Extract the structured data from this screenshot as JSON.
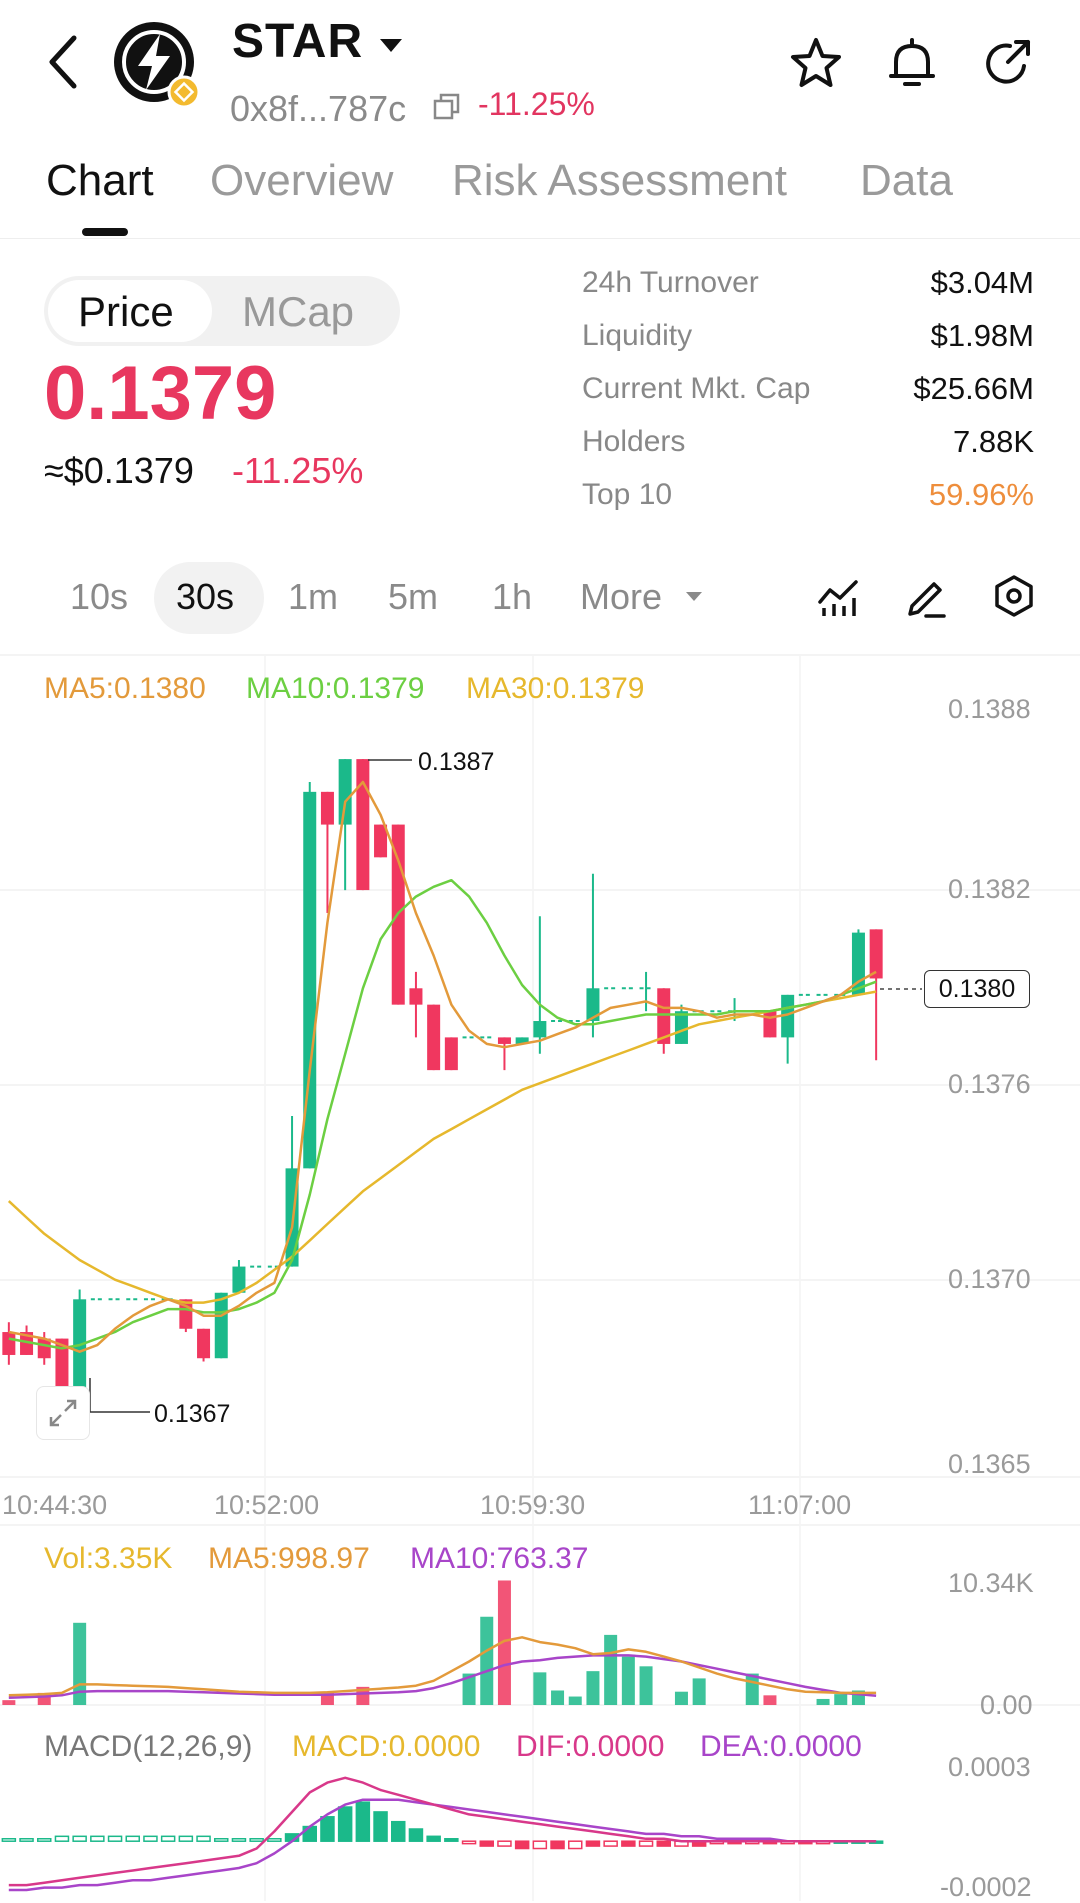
{
  "header": {
    "token_name": "STAR",
    "address": "0x8f...787c",
    "change": "-11.25%",
    "icons": [
      "back-arrow-icon",
      "caret-down-icon",
      "copy-icon",
      "star-icon",
      "bell-icon",
      "share-icon"
    ]
  },
  "tabs": [
    {
      "label": "Chart",
      "active": true
    },
    {
      "label": "Overview",
      "active": false
    },
    {
      "label": "Risk Assessment",
      "active": false
    },
    {
      "label": "Data",
      "active": false
    }
  ],
  "price_panel": {
    "toggle": [
      "Price",
      "MCap"
    ],
    "price": "0.1379",
    "usd_price": "≈$0.1379",
    "change": "-11.25%"
  },
  "stats": [
    {
      "label": "24h   Turnover",
      "value": "$3.04M"
    },
    {
      "label": "Liquidity",
      "value": "$1.98M"
    },
    {
      "label": "Current Mkt. Cap",
      "value": "$25.66M"
    },
    {
      "label": "Holders",
      "value": "7.88K"
    },
    {
      "label": "Top 10",
      "value": "59.96%"
    }
  ],
  "intervals": [
    "10s",
    "30s",
    "1m",
    "5m",
    "1h",
    "More"
  ],
  "selected_interval": "30s",
  "colors": {
    "up": "#1bb98a",
    "down": "#f0375f",
    "ma5": "#e39a3b",
    "ma10": "#6ccf42",
    "ma30": "#e6b82d",
    "macd": "#e6b82d",
    "dif": "#d8388a",
    "dea": "#a845c9"
  },
  "chart": {
    "ma_labels": [
      "MA5:0.1380",
      "MA10:0.1379",
      "MA30:0.1379"
    ],
    "y_labels": [
      "0.1388",
      "0.1382",
      "0.1376",
      "0.1370",
      "0.1365"
    ],
    "x_labels": [
      "10:44:30",
      "10:52:00",
      "10:59:30",
      "11:07:00"
    ],
    "high_label": "0.1387",
    "low_label": "0.1367",
    "last_price_tag": "0.1380",
    "volume_labels": [
      "Vol:3.35K",
      "MA5:998.97",
      "MA10:763.37"
    ],
    "volume_axis": [
      "10.34K",
      "0.00"
    ],
    "macd_labels": [
      "MACD(12,26,9)",
      "MACD:0.0000",
      "DIF:0.0000",
      "DEA:0.0000"
    ],
    "macd_axis": [
      "0.0003",
      "-0.0002"
    ]
  },
  "chart_data": {
    "type": "candlestick",
    "y_range": [
      0.1365,
      0.1388
    ],
    "candles": [
      {
        "o": 0.1369,
        "h": 0.13693,
        "l": 0.1368,
        "c": 0.13683
      },
      {
        "o": 0.1369,
        "h": 0.13692,
        "l": 0.13683,
        "c": 0.13683
      },
      {
        "o": 0.13688,
        "h": 0.1369,
        "l": 0.1368,
        "c": 0.13682
      },
      {
        "o": 0.13688,
        "h": 0.13688,
        "l": 0.13669,
        "c": 0.13671
      },
      {
        "o": 0.13671,
        "h": 0.13703,
        "l": 0.13669,
        "c": 0.137
      },
      {
        "o": 0.137,
        "h": 0.137,
        "l": 0.137,
        "c": 0.137
      },
      {
        "o": 0.137,
        "h": 0.137,
        "l": 0.137,
        "c": 0.137
      },
      {
        "o": 0.137,
        "h": 0.137,
        "l": 0.137,
        "c": 0.137
      },
      {
        "o": 0.137,
        "h": 0.137,
        "l": 0.137,
        "c": 0.137
      },
      {
        "o": 0.137,
        "h": 0.137,
        "l": 0.137,
        "c": 0.137
      },
      {
        "o": 0.137,
        "h": 0.137,
        "l": 0.1369,
        "c": 0.13691
      },
      {
        "o": 0.13691,
        "h": 0.13691,
        "l": 0.13681,
        "c": 0.13682
      },
      {
        "o": 0.13682,
        "h": 0.13702,
        "l": 0.13682,
        "c": 0.13702
      },
      {
        "o": 0.13702,
        "h": 0.13712,
        "l": 0.13702,
        "c": 0.1371
      },
      {
        "o": 0.1371,
        "h": 0.1371,
        "l": 0.1371,
        "c": 0.1371
      },
      {
        "o": 0.1371,
        "h": 0.1371,
        "l": 0.1371,
        "c": 0.1371
      },
      {
        "o": 0.1371,
        "h": 0.13756,
        "l": 0.1371,
        "c": 0.1374
      },
      {
        "o": 0.1374,
        "h": 0.13858,
        "l": 0.1374,
        "c": 0.13855
      },
      {
        "o": 0.13855,
        "h": 0.13855,
        "l": 0.13818,
        "c": 0.13845
      },
      {
        "o": 0.13845,
        "h": 0.13865,
        "l": 0.13825,
        "c": 0.13865
      },
      {
        "o": 0.13865,
        "h": 0.13865,
        "l": 0.13825,
        "c": 0.13825
      },
      {
        "o": 0.13845,
        "h": 0.13845,
        "l": 0.13835,
        "c": 0.13835
      },
      {
        "o": 0.13845,
        "h": 0.13845,
        "l": 0.1379,
        "c": 0.1379
      },
      {
        "o": 0.13795,
        "h": 0.138,
        "l": 0.1378,
        "c": 0.1379
      },
      {
        "o": 0.1379,
        "h": 0.1379,
        "l": 0.1377,
        "c": 0.1377
      },
      {
        "o": 0.1378,
        "h": 0.1378,
        "l": 0.1377,
        "c": 0.1377
      },
      {
        "o": 0.1378,
        "h": 0.1378,
        "l": 0.1378,
        "c": 0.1378
      },
      {
        "o": 0.1378,
        "h": 0.1378,
        "l": 0.1378,
        "c": 0.1378
      },
      {
        "o": 0.1378,
        "h": 0.1378,
        "l": 0.1377,
        "c": 0.13778
      },
      {
        "o": 0.13778,
        "h": 0.1378,
        "l": 0.13778,
        "c": 0.1378
      },
      {
        "o": 0.1378,
        "h": 0.13817,
        "l": 0.13775,
        "c": 0.13785
      },
      {
        "o": 0.13785,
        "h": 0.13785,
        "l": 0.13785,
        "c": 0.13785
      },
      {
        "o": 0.13785,
        "h": 0.13785,
        "l": 0.13785,
        "c": 0.13785
      },
      {
        "o": 0.13785,
        "h": 0.1383,
        "l": 0.1378,
        "c": 0.13795
      },
      {
        "o": 0.13795,
        "h": 0.13795,
        "l": 0.13795,
        "c": 0.13795
      },
      {
        "o": 0.13795,
        "h": 0.13795,
        "l": 0.13795,
        "c": 0.13795
      },
      {
        "o": 0.13795,
        "h": 0.138,
        "l": 0.13788,
        "c": 0.13795
      },
      {
        "o": 0.13795,
        "h": 0.13795,
        "l": 0.13775,
        "c": 0.13778
      },
      {
        "o": 0.13778,
        "h": 0.1379,
        "l": 0.13778,
        "c": 0.13788
      },
      {
        "o": 0.13788,
        "h": 0.13788,
        "l": 0.13788,
        "c": 0.13788
      },
      {
        "o": 0.13788,
        "h": 0.13788,
        "l": 0.13788,
        "c": 0.13788
      },
      {
        "o": 0.13788,
        "h": 0.13792,
        "l": 0.13785,
        "c": 0.13788
      },
      {
        "o": 0.13788,
        "h": 0.13788,
        "l": 0.13788,
        "c": 0.13788
      },
      {
        "o": 0.13788,
        "h": 0.13788,
        "l": 0.1378,
        "c": 0.1378
      },
      {
        "o": 0.1378,
        "h": 0.13793,
        "l": 0.13772,
        "c": 0.13793
      },
      {
        "o": 0.13793,
        "h": 0.13793,
        "l": 0.13793,
        "c": 0.13793
      },
      {
        "o": 0.13793,
        "h": 0.13793,
        "l": 0.13793,
        "c": 0.13793
      },
      {
        "o": 0.13793,
        "h": 0.13793,
        "l": 0.13793,
        "c": 0.13793
      },
      {
        "o": 0.13793,
        "h": 0.13813,
        "l": 0.13793,
        "c": 0.13812
      },
      {
        "o": 0.13813,
        "h": 0.13813,
        "l": 0.13773,
        "c": 0.13798
      }
    ],
    "ma5": [
      0.1369,
      0.13689,
      0.13688,
      0.13686,
      0.13684,
      0.13686,
      0.13691,
      0.13695,
      0.13698,
      0.137,
      0.13698,
      0.13695,
      0.13695,
      0.13698,
      0.13702,
      0.13705,
      0.13722,
      0.1377,
      0.13815,
      0.13852,
      0.13858,
      0.13848,
      0.13834,
      0.13818,
      0.13805,
      0.1379,
      0.13782,
      0.13778,
      0.13777,
      0.13778,
      0.13779,
      0.13781,
      0.13783,
      0.13786,
      0.13789,
      0.1379,
      0.13791,
      0.13789,
      0.13789,
      0.13788,
      0.13786,
      0.13787,
      0.13787,
      0.13786,
      0.13787,
      0.13789,
      0.13791,
      0.13793,
      0.13797,
      0.138
    ],
    "ma10": [
      0.13688,
      0.13687,
      0.13686,
      0.13685,
      0.13686,
      0.13688,
      0.1369,
      0.13693,
      0.13695,
      0.13697,
      0.13697,
      0.13696,
      0.13696,
      0.13697,
      0.13699,
      0.13702,
      0.13712,
      0.13732,
      0.13755,
      0.13775,
      0.13795,
      0.1381,
      0.13818,
      0.13823,
      0.13826,
      0.13828,
      0.13823,
      0.13815,
      0.13805,
      0.13796,
      0.1379,
      0.13786,
      0.13784,
      0.13784,
      0.13785,
      0.13786,
      0.13787,
      0.13787,
      0.13787,
      0.13787,
      0.13787,
      0.13788,
      0.13788,
      0.13788,
      0.13789,
      0.1379,
      0.13791,
      0.13793,
      0.13795,
      0.13797
    ],
    "ma30": [
      0.1373,
      0.13725,
      0.1372,
      0.13716,
      0.13712,
      0.13709,
      0.13706,
      0.13704,
      0.13702,
      0.137,
      0.13699,
      0.13699,
      0.137,
      0.13702,
      0.13705,
      0.13709,
      0.13713,
      0.13718,
      0.13723,
      0.13728,
      0.13733,
      0.13737,
      0.13741,
      0.13745,
      0.13749,
      0.13752,
      0.13755,
      0.13758,
      0.13761,
      0.13764,
      0.13766,
      0.13768,
      0.1377,
      0.13772,
      0.13774,
      0.13776,
      0.13778,
      0.1378,
      0.13782,
      0.13784,
      0.13785,
      0.13786,
      0.13787,
      0.13788,
      0.13789,
      0.1379,
      0.13791,
      0.13792,
      0.13793,
      0.13794
    ],
    "volume": [
      400,
      0,
      1000,
      0,
      6800,
      0,
      0,
      0,
      0,
      0,
      0,
      0,
      0,
      0,
      0,
      0,
      0,
      0,
      1000,
      0,
      1500,
      0,
      0,
      0,
      0,
      0,
      2600,
      7300,
      10300,
      0,
      2700,
      1200,
      700,
      2800,
      5800,
      4000,
      3200,
      0,
      1100,
      2200,
      0,
      0,
      2600,
      800,
      0,
      0,
      500,
      900,
      1200,
      0
    ],
    "vol_ma5": [
      800,
      850,
      900,
      1000,
      1700,
      1700,
      1650,
      1600,
      1550,
      1500,
      1400,
      1300,
      1200,
      1100,
      1050,
      1000,
      1000,
      1000,
      1050,
      1150,
      1250,
      1350,
      1450,
      1600,
      2000,
      2800,
      3600,
      4500,
      5300,
      5600,
      5200,
      5000,
      4700,
      4200,
      4300,
      4600,
      4400,
      4000,
      3600,
      3100,
      2600,
      2200,
      1900,
      1600,
      1300,
      1100,
      1050,
      1000,
      1000,
      998.97
    ],
    "vol_ma10": [
      600,
      650,
      700,
      800,
      1100,
      1150,
      1150,
      1150,
      1150,
      1150,
      1100,
      1050,
      1000,
      950,
      900,
      850,
      850,
      850,
      850,
      900,
      950,
      1000,
      1050,
      1150,
      1400,
      1800,
      2300,
      2800,
      3300,
      3600,
      3700,
      3900,
      4000,
      4100,
      4100,
      4100,
      4000,
      3800,
      3600,
      3300,
      3000,
      2700,
      2400,
      2100,
      1800,
      1500,
      1250,
      1000,
      900,
      763.37
    ],
    "macd_hist": [
      1e-05,
      1e-05,
      1e-05,
      2e-05,
      2e-05,
      2e-05,
      2e-05,
      2e-05,
      2e-05,
      2e-05,
      2e-05,
      2e-05,
      1e-05,
      1e-05,
      1e-05,
      1e-05,
      3e-05,
      6e-05,
      0.0001,
      0.00014,
      0.00016,
      0.00012,
      8e-05,
      5e-05,
      2e-05,
      1e-05,
      -1e-05,
      -2e-05,
      -2e-05,
      -3e-05,
      -3e-05,
      -3e-05,
      -3e-05,
      -2e-05,
      -2e-05,
      -2e-05,
      -2e-05,
      -2e-05,
      -2e-05,
      -2e-05,
      -1e-05,
      -1e-05,
      -1e-05,
      -1e-05,
      -1e-05,
      -1e-05,
      -1e-05,
      0.0,
      0.0,
      0.0
    ],
    "dif": [
      -0.00018,
      -0.00018,
      -0.00017,
      -0.00016,
      -0.00015,
      -0.00014,
      -0.00013,
      -0.00012,
      -0.00011,
      -0.0001,
      -9e-05,
      -8e-05,
      -7e-05,
      -6e-05,
      -3e-05,
      4e-05,
      0.00012,
      0.0002,
      0.00024,
      0.00026,
      0.00024,
      0.00021,
      0.00019,
      0.00017,
      0.00015,
      0.00013,
      0.00011,
      0.0001,
      9e-05,
      8e-05,
      7e-05,
      6e-05,
      5e-05,
      4e-05,
      3e-05,
      2e-05,
      1e-05,
      1e-05,
      0.0,
      0.0,
      0.0,
      0.0,
      0.0,
      0.0,
      0.0,
      0.0,
      0.0,
      0.0,
      0.0,
      0.0
    ],
    "dea": [
      -0.0002,
      -0.0002,
      -0.00019,
      -0.00019,
      -0.00018,
      -0.00018,
      -0.00017,
      -0.00016,
      -0.00016,
      -0.00015,
      -0.00014,
      -0.00013,
      -0.00012,
      -0.00011,
      -9e-05,
      -5e-05,
      0.0,
      6e-05,
      0.00011,
      0.00015,
      0.00017,
      0.00017,
      0.00017,
      0.00016,
      0.00015,
      0.00014,
      0.00013,
      0.00012,
      0.00011,
      0.0001,
      9e-05,
      8e-05,
      7e-05,
      6e-05,
      5e-05,
      4e-05,
      3e-05,
      3e-05,
      2e-05,
      2e-05,
      1e-05,
      1e-05,
      1e-05,
      1e-05,
      0.0,
      0.0,
      0.0,
      0.0,
      0.0,
      0.0
    ]
  }
}
